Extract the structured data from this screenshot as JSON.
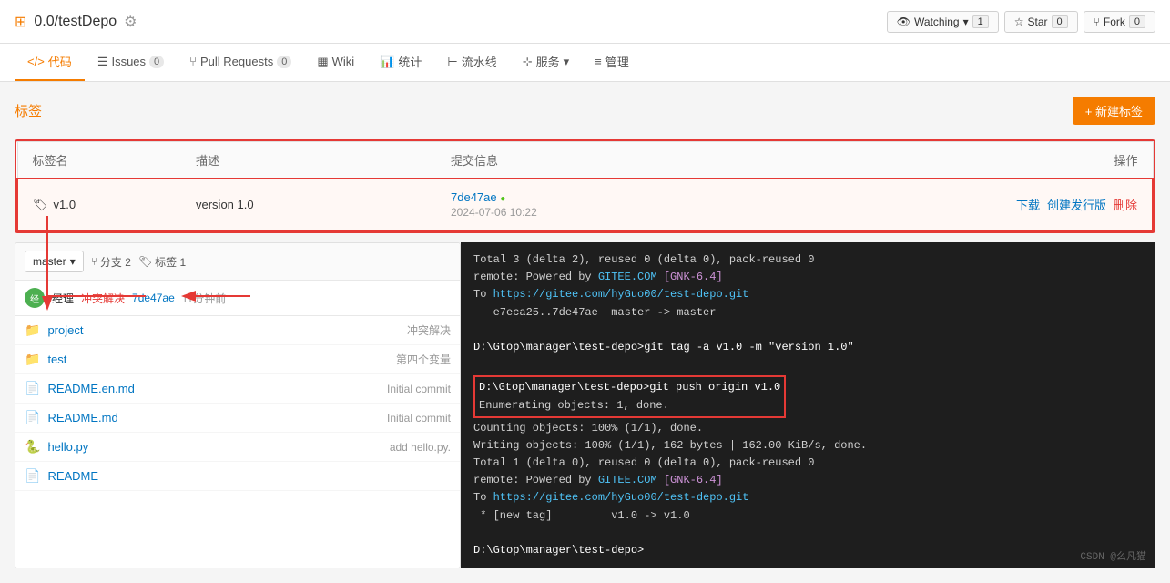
{
  "header": {
    "repo_icon": "⊞",
    "repo_path": "0.0/testDepo",
    "settings_icon": "⚙",
    "watching_label": "Watching",
    "watching_count": "1",
    "star_label": "Star",
    "star_count": "0",
    "fork_label": "Fork",
    "fork_count": "0"
  },
  "nav": {
    "tabs": [
      {
        "label": "代码",
        "icon": "</>",
        "badge": null,
        "active": true
      },
      {
        "label": "Issues",
        "icon": "☰",
        "badge": "0",
        "active": false
      },
      {
        "label": "Pull Requests",
        "icon": "⑂",
        "badge": "0",
        "active": false
      },
      {
        "label": "Wiki",
        "icon": "▦",
        "badge": null,
        "active": false
      },
      {
        "label": "统计",
        "icon": "⟩|⟨",
        "badge": null,
        "active": false
      },
      {
        "label": "流水线",
        "icon": "⊢",
        "badge": null,
        "active": false
      },
      {
        "label": "服务",
        "icon": "⊹",
        "badge": null,
        "active": false
      },
      {
        "label": "管理",
        "icon": "≡",
        "badge": null,
        "active": false
      }
    ]
  },
  "tags_page": {
    "title": "标签",
    "new_tag_btn": "+ 新建标签",
    "table_headers": [
      "标签名",
      "描述",
      "提交信息",
      "操作"
    ],
    "tags": [
      {
        "name": "v1.0",
        "description": "version 1.0",
        "commit_hash": "7de47ae",
        "commit_date": "2024-07-06 10:22",
        "actions": [
          "下载",
          "创建发行版",
          "删除"
        ]
      }
    ]
  },
  "file_browser": {
    "branch": "master",
    "branches_count": "分支 2",
    "tags_count": "标签 1",
    "commit_author": "经理",
    "commit_label": "冲突解决",
    "commit_sha": "7de47ae",
    "commit_time": "11分钟前",
    "files": [
      {
        "icon": "folder",
        "name": "project",
        "commit_msg": "冲突解决"
      },
      {
        "icon": "folder",
        "name": "test",
        "commit_msg": "第四个变量"
      },
      {
        "icon": "md",
        "name": "README.en.md",
        "commit_msg": "Initial commit"
      },
      {
        "icon": "md",
        "name": "README.md",
        "commit_msg": "Initial commit"
      },
      {
        "icon": "py",
        "name": "hello.py",
        "commit_msg": "add hello.py."
      },
      {
        "icon": "md",
        "name": "README",
        "commit_msg": ""
      }
    ]
  },
  "terminal": {
    "lines": [
      "Total 3 (delta 2), reused 0 (delta 0), pack-reused 0",
      "remote: Powered by GITEE.COM [GNK-6.4]",
      "To https://gitee.com/hyGuo00/test-depo.git",
      "   e7eca25..7de47ae  master -> master",
      "",
      "D:\\Gtop\\manager\\test-depo>git tag -a v1.0 -m \"version 1.0\"",
      "",
      "D:\\Gtop\\manager\\test-depo>git push origin v1.0",
      "Enumerating objects: 1, done.",
      "Counting objects: 100% (1/1), done.",
      "Writing objects: 100% (1/1), 162 bytes | 162.00 KiB/s, done.",
      "Total 1 (delta 0), reused 0 (delta 0), pack-reused 0",
      "remote: Powered by GITEE.COM [GNK-6.4]",
      "To https://gitee.com/hyGuo00/test-depo.git",
      " * [new tag]         v1.0 -> v1.0",
      "",
      "D:\\Gtop\\manager\\test-depo>"
    ],
    "csdn_watermark": "CSDN @么凡猫"
  }
}
